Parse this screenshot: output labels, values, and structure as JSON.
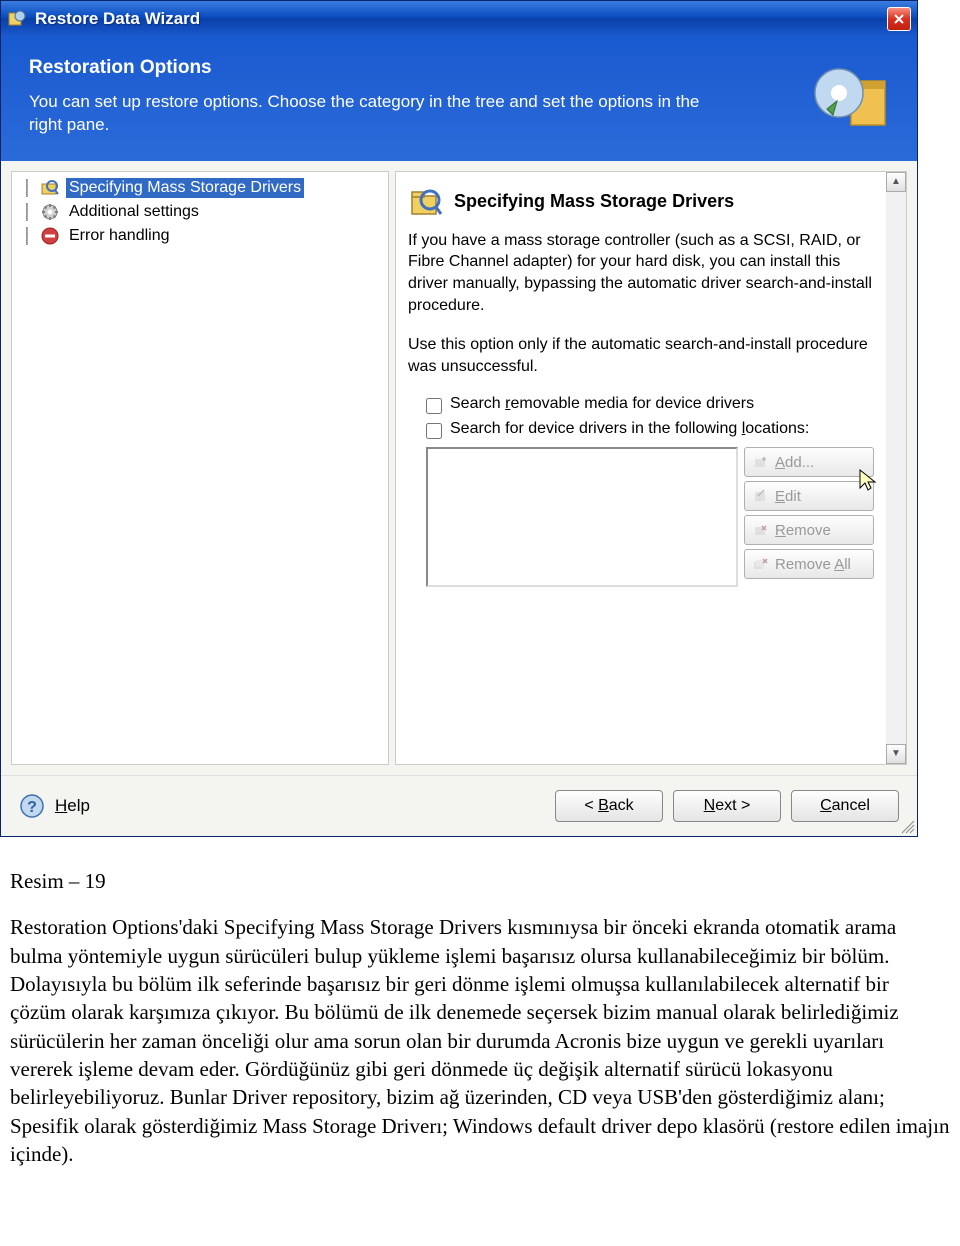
{
  "window": {
    "title": "Restore Data Wizard"
  },
  "header": {
    "title": "Restoration Options",
    "description": "You can set up restore options. Choose the category in the tree and set the options in the right pane."
  },
  "tree": {
    "items": [
      {
        "label": "Specifying Mass Storage Drivers",
        "selected": true
      },
      {
        "label": "Additional settings",
        "selected": false
      },
      {
        "label": "Error handling",
        "selected": false
      }
    ]
  },
  "detail": {
    "title": "Specifying Mass Storage Drivers",
    "para1": "If you have a mass storage controller (such as a SCSI, RAID, or Fibre Channel adapter) for your hard disk, you can install this driver manually, bypassing the automatic driver search-and-install procedure.",
    "para2": "Use this option only if the automatic search-and-install procedure was unsuccessful.",
    "checkbox1": "Search removable media for device drivers",
    "checkbox2": "Search for device drivers in the following locations:",
    "buttons": {
      "add": "Add...",
      "edit": "Edit",
      "remove": "Remove",
      "remove_all": "Remove All"
    }
  },
  "footer": {
    "help": "Help",
    "back": "< Back",
    "next": "Next >",
    "cancel": "Cancel"
  },
  "article": {
    "caption": "Resim – 19",
    "body": "Restoration Options'daki Specifying Mass Storage Drivers kısmınıysa bir önceki ekranda otomatik arama bulma yöntemiyle uygun sürücüleri bulup yükleme işlemi başarısız olursa kullanabileceğimiz bir bölüm. Dolayısıyla bu bölüm ilk seferinde başarısız bir geri dönme işlemi olmuşsa kullanılabilecek alternatif bir çözüm olarak karşımıza çıkıyor. Bu bölümü de ilk denemede seçersek bizim manual olarak belirlediğimiz sürücülerin her zaman önceliği olur ama sorun olan bir durumda Acronis bize uygun ve gerekli uyarıları vererek işleme devam eder. Gördüğünüz gibi geri dönmede üç değişik alternatif sürücü lokasyonu belirleyebiliyoruz. Bunlar Driver repository, bizim ağ üzerinden, CD veya USB'den gösterdiğimiz alanı; Spesifik olarak gösterdiğimiz Mass Storage Driverı; Windows default driver depo klasörü (restore edilen imajın içinde)."
  }
}
